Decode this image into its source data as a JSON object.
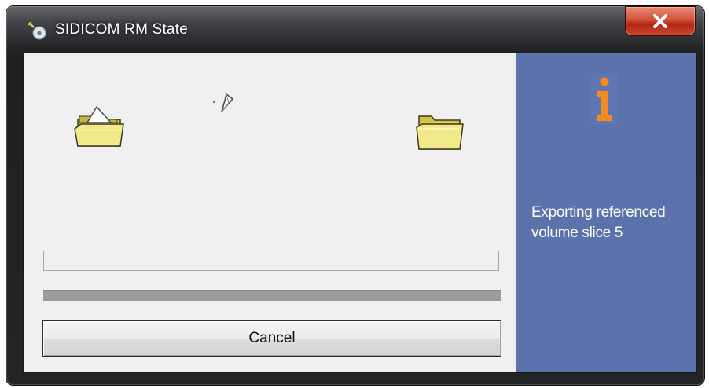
{
  "window": {
    "title": "SIDICOM RM State",
    "close_label": "close"
  },
  "dialog": {
    "status_message": "Exporting referenced volume slice 5",
    "filename_value": "",
    "progress_fraction": 0,
    "cancel_label": "Cancel"
  },
  "icons": {
    "app": "disc-icon",
    "source_folder": "open-folder-icon",
    "destination_folder": "folder-icon",
    "flying_document": "document-icon",
    "info": "info-icon",
    "close": "close-icon"
  },
  "colors": {
    "side_panel": "#5b72ad",
    "info_icon": "#f58a1f",
    "close_button": "#c8412a"
  }
}
